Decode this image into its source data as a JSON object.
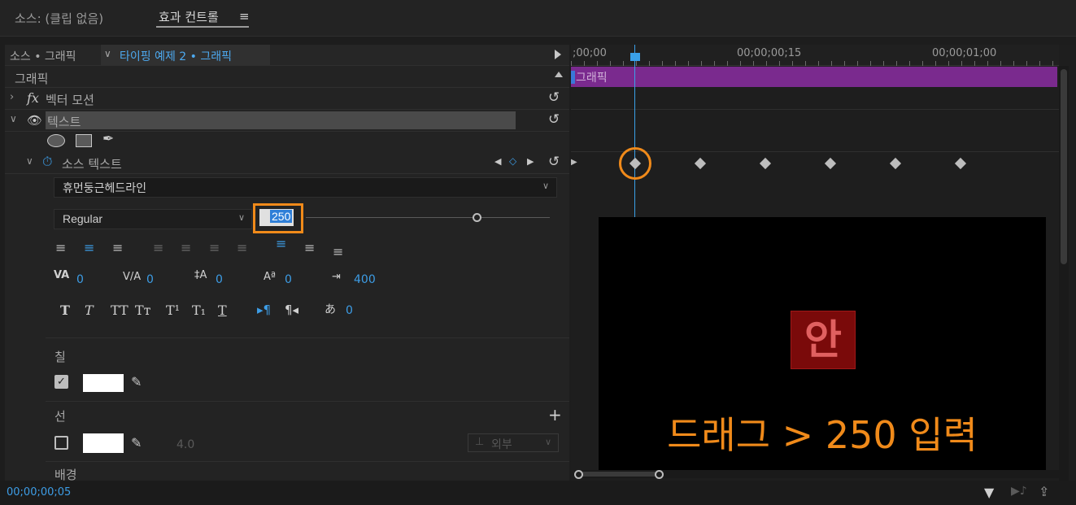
{
  "header": {
    "source_label": "소스: (클립 없음)",
    "active_tab": "효과 컨트롤",
    "menu_icon": "≡"
  },
  "breadcrumbs": {
    "source": "소스 • 그래픽",
    "clip": "타이핑 예제 2 • 그래픽"
  },
  "section": {
    "title": "그래픽"
  },
  "effects": {
    "vector_motion": "벡터 모션",
    "text": "텍스트",
    "source_text": "소스 텍스트"
  },
  "font": {
    "family": "휴먼둥근헤드라인",
    "style": "Regular",
    "size": "250",
    "size_slider_fraction": 0.7
  },
  "typography": {
    "kerning": "0",
    "tracking": "0",
    "leading": "0",
    "baseline": "0",
    "tab_width": "400",
    "tsume": "0"
  },
  "fill": {
    "label": "칠",
    "checked": true,
    "color": "#ffffff"
  },
  "stroke": {
    "label": "선",
    "checked": false,
    "color": "#ffffff",
    "width": "4.0",
    "position": "외부"
  },
  "background": {
    "label": "배경"
  },
  "timeline": {
    "t0": ";00;00",
    "t1": "00;00;00;15",
    "t2": "00;00;01;00",
    "clip_label": "그래픽"
  },
  "monitor": {
    "glyph": "안",
    "instruction": "드래그 > 250 입력"
  },
  "footer": {
    "timecode": "00;00;00;05"
  },
  "colors": {
    "accent_blue": "#3d9de6",
    "highlight_orange": "#f08a1a",
    "clip_purple": "#7a2a8e"
  }
}
